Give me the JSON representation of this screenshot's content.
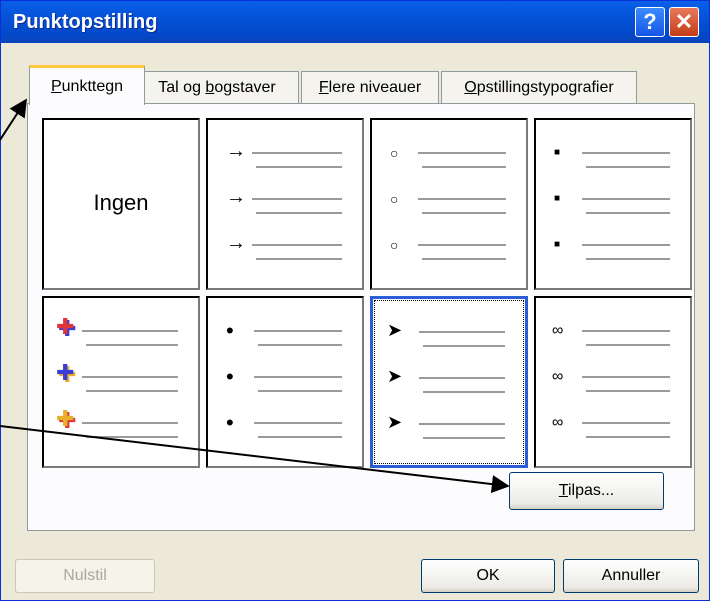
{
  "window": {
    "title": "Punktopstilling",
    "help_glyph": "?",
    "close_glyph": "✕"
  },
  "tabs": [
    {
      "label": "Punkttegn",
      "mnemonic_index": 0,
      "active": true
    },
    {
      "label": "Tal og bogstaver",
      "mnemonic_index": 7,
      "active": false
    },
    {
      "label": "Flere niveauer",
      "mnemonic_index": 0,
      "active": false
    },
    {
      "label": "Opstillingstypografier",
      "mnemonic_index": 0,
      "active": false
    }
  ],
  "bullet_gallery": [
    {
      "label": "Ingen",
      "symbol": null,
      "icon": "none"
    },
    {
      "symbol": "→",
      "icon": "arrow-bullet-icon"
    },
    {
      "symbol": "○",
      "icon": "hollow-circle-bullet-icon"
    },
    {
      "symbol": "■",
      "icon": "square-bullet-icon"
    },
    {
      "symbol": "✚",
      "icon": "colored-cross-bullet-icon",
      "colors": [
        "#e0343b",
        "#3b3bd6",
        "#e8b12a"
      ]
    },
    {
      "symbol": "•",
      "icon": "dot-bullet-icon"
    },
    {
      "symbol": "➤",
      "icon": "arrowhead-bullet-icon",
      "selected": true
    },
    {
      "symbol": "∞",
      "icon": "infinity-bullet-icon"
    }
  ],
  "buttons": {
    "customize": {
      "label": "Tilpas...",
      "mnemonic_index": 0
    },
    "reset": {
      "label": "Nulstil",
      "enabled": false
    },
    "ok": {
      "label": "OK"
    },
    "cancel": {
      "label": "Annuller"
    }
  },
  "colors": {
    "titlebar": "#0550d6",
    "dialog_bg": "#ece9d8",
    "selection": "#2b5ed6",
    "active_tab_accent": "#ffc83c"
  }
}
